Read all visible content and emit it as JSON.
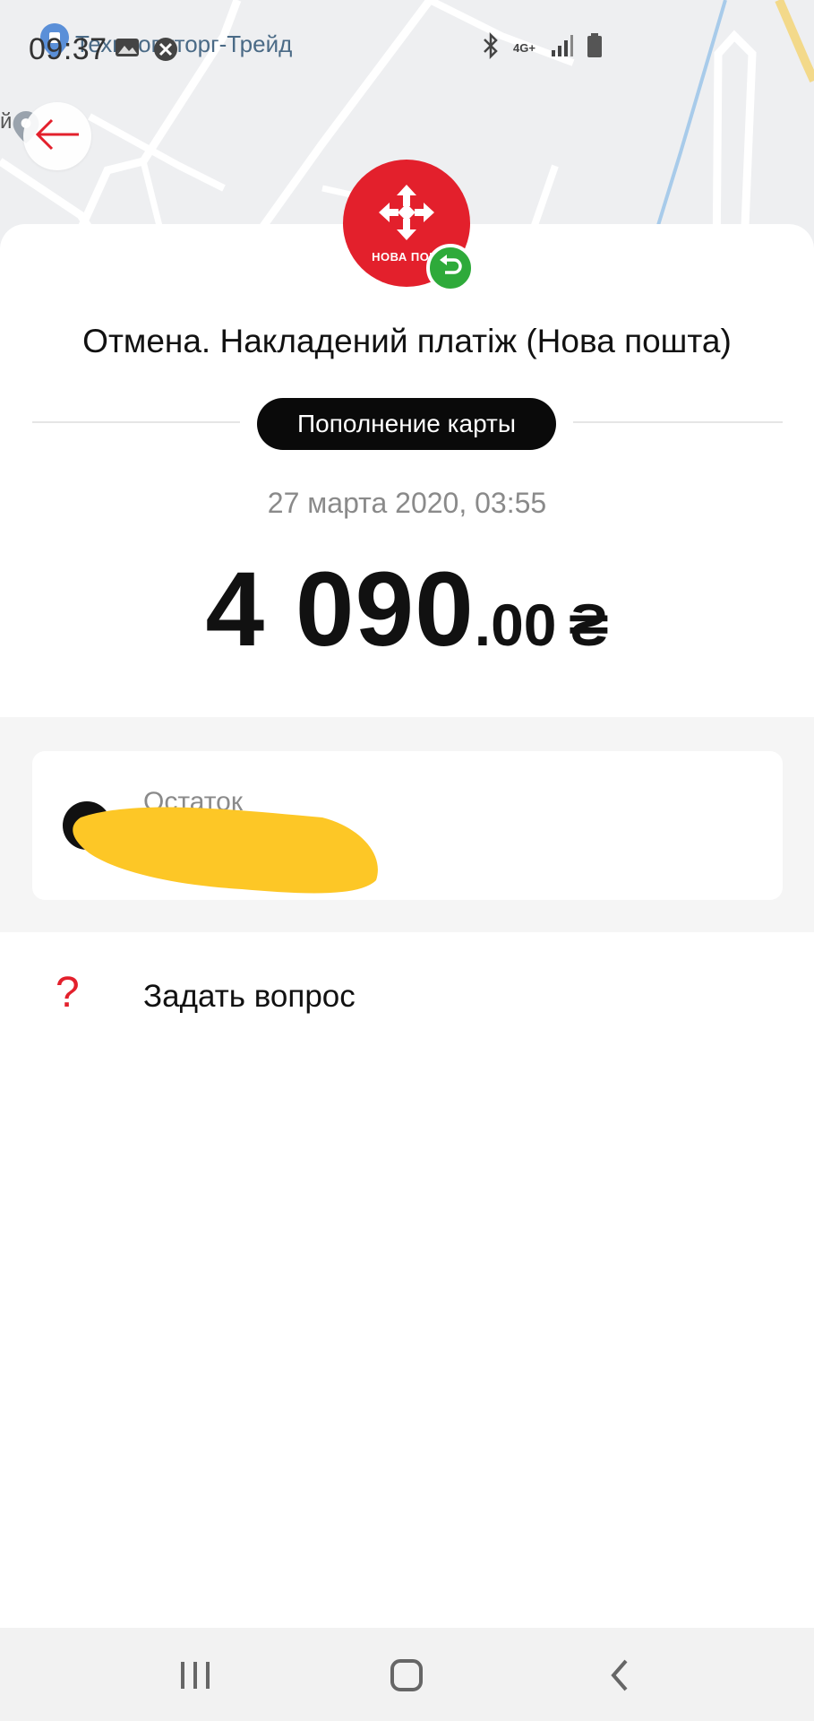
{
  "status_bar": {
    "time": "09:37",
    "network": "4G+"
  },
  "map": {
    "place_label": "Технооптторг-Трейд",
    "side_label": "й"
  },
  "merchant": {
    "logo_text": "НОВА ПОШ",
    "brand_color": "#e3202c",
    "refund_color": "#2eaa3a"
  },
  "transaction": {
    "title": "Отмена. Накладений платіж (Нова пошта)",
    "category": "Пополнение карты",
    "date": "27 марта 2020, 03:55",
    "amount_int": "4 090",
    "amount_dec": ".00",
    "currency": "₴"
  },
  "balance": {
    "label": "Остаток"
  },
  "actions": {
    "ask_label": "Задать вопрос",
    "ask_icon": "?"
  },
  "icons": {
    "back": "arrow-left-icon",
    "refund": "undo-icon",
    "ask": "question-icon"
  }
}
